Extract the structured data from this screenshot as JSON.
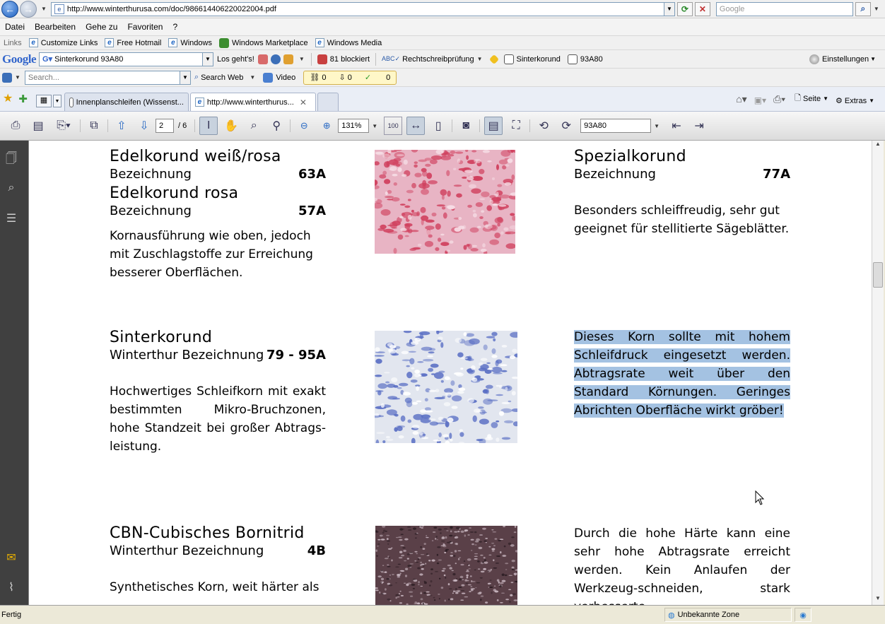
{
  "browser": {
    "address_url": "http://www.winterthurusa.com/doc/986614406220022004.pdf",
    "search_placeholder": "Google"
  },
  "menu": [
    "Datei",
    "Bearbeiten",
    "Gehe zu",
    "Favoriten",
    "?"
  ],
  "links_bar": {
    "label": "Links",
    "items": [
      "Customize Links",
      "Free Hotmail",
      "Windows",
      "Windows Marketplace",
      "Windows Media"
    ]
  },
  "google_toolbar": {
    "logo": "Google",
    "query": "Sinterkorund 93A80",
    "go_label": "Los geht's!",
    "blocked_label": "81 blockiert",
    "spellcheck_label": "Rechtschreibprüfung",
    "term1": "Sinterkorund",
    "term2": "93A80",
    "settings_label": "Einstellungen"
  },
  "search_toolbar": {
    "placeholder": "Search...",
    "search_web_label": "Search Web",
    "video_label": "Video",
    "counts": [
      "0",
      "0",
      "0"
    ]
  },
  "tabs": [
    {
      "label": "Innenplanschleifen (Wissenst..."
    },
    {
      "label": "http://www.winterthurus..."
    }
  ],
  "tab_toolbar": {
    "page_label": "Seite",
    "extras_label": "Extras"
  },
  "pdf_toolbar": {
    "page_current": "2",
    "page_total": "/ 6",
    "zoom": "131%",
    "find_value": "93A80"
  },
  "document": {
    "left_col": {
      "s1_title1": "Edelkorund weiß/rosa",
      "s1_label1": "Bezeichnung",
      "s1_code1": "63A",
      "s1_title2": "Edelkorund rosa",
      "s1_label2": "Bezeichnung",
      "s1_code2": "57A",
      "s1_text": "Kornausführung wie oben, jedoch mit Zuschlagstoffe zur Erreichung besserer Oberflächen.",
      "s2_title": "Sinterkorund",
      "s2_label": "Winterthur Bezeichnung",
      "s2_code": "79 - 95A",
      "s2_text": "Hochwertiges Schleifkorn mit exakt bestimmten Mikro-Bruchzonen, hohe Standzeit bei großer Abtrags-leistung.",
      "s3_title": "CBN-Cubisches Bornitrid",
      "s3_label": "Winterthur Bezeichnung",
      "s3_code": "4B",
      "s3_text": "Synthetisches Korn, weit härter als"
    },
    "right_col": {
      "r1_title": "Spezialkorund",
      "r1_label": "Bezeichnung",
      "r1_code": "77A",
      "r1_text": "Besonders schleiffreudig, sehr gut geeignet für stellitierte Sägeblätter.",
      "r2_text": "Dieses Korn sollte mit hohem Schleifdruck eingesetzt werden. Abtragsrate weit über den Standard Körnungen. Geringes Abrichten Oberfläche wirkt gröber!",
      "r3_text": "Durch die hohe Härte kann eine sehr hohe Abtragsrate erreicht werden. Kein Anlaufen der Werkzeug-schneiden, stark verbesserte"
    },
    "swatch_colors": {
      "pink_base": "#e8b4c4",
      "pink_spot": "#d0405e",
      "blue_base": "#e2e6ef",
      "blue_spot": "#5a6fc4",
      "brown_base": "#5a4048",
      "brown_spot": "#c8b6c0"
    }
  },
  "statusbar": {
    "status": "Fertig",
    "zone": "Unbekannte Zone"
  }
}
